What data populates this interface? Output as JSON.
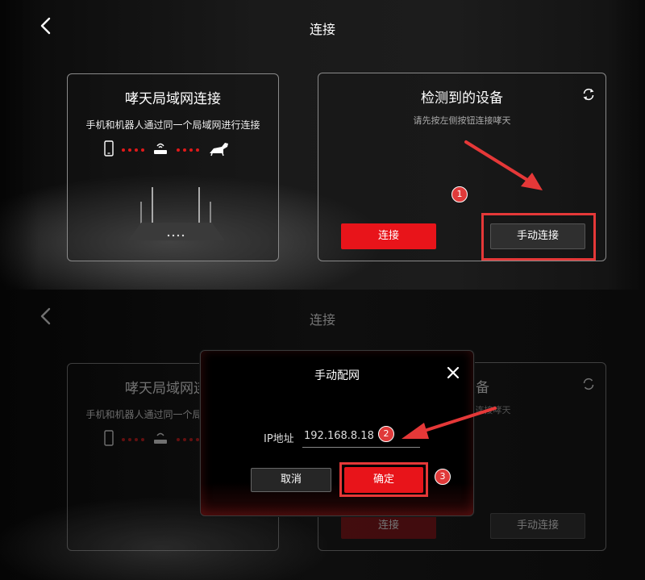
{
  "header": {
    "title": "连接"
  },
  "lan_card": {
    "title": "哮天局域网连接",
    "subtitle": "手机和机器人通过同一个局域网进行连接"
  },
  "device_card": {
    "title": "检测到的设备",
    "hint": "请先按左侧按钮连接哮天",
    "connect_label": "连接",
    "manual_label": "手动连接"
  },
  "dialog": {
    "title": "手动配网",
    "ip_label": "IP地址",
    "ip_value": "192.168.8.18",
    "cancel_label": "取消",
    "confirm_label": "确定"
  },
  "steps": [
    "1",
    "2",
    "3"
  ],
  "colors": {
    "accent": "#e8141a",
    "annotation": "#e53838",
    "background": "#000000"
  },
  "icons": [
    "back-arrow-icon",
    "refresh-icon",
    "phone-icon",
    "router-icon",
    "robot-dog-icon",
    "close-icon"
  ]
}
